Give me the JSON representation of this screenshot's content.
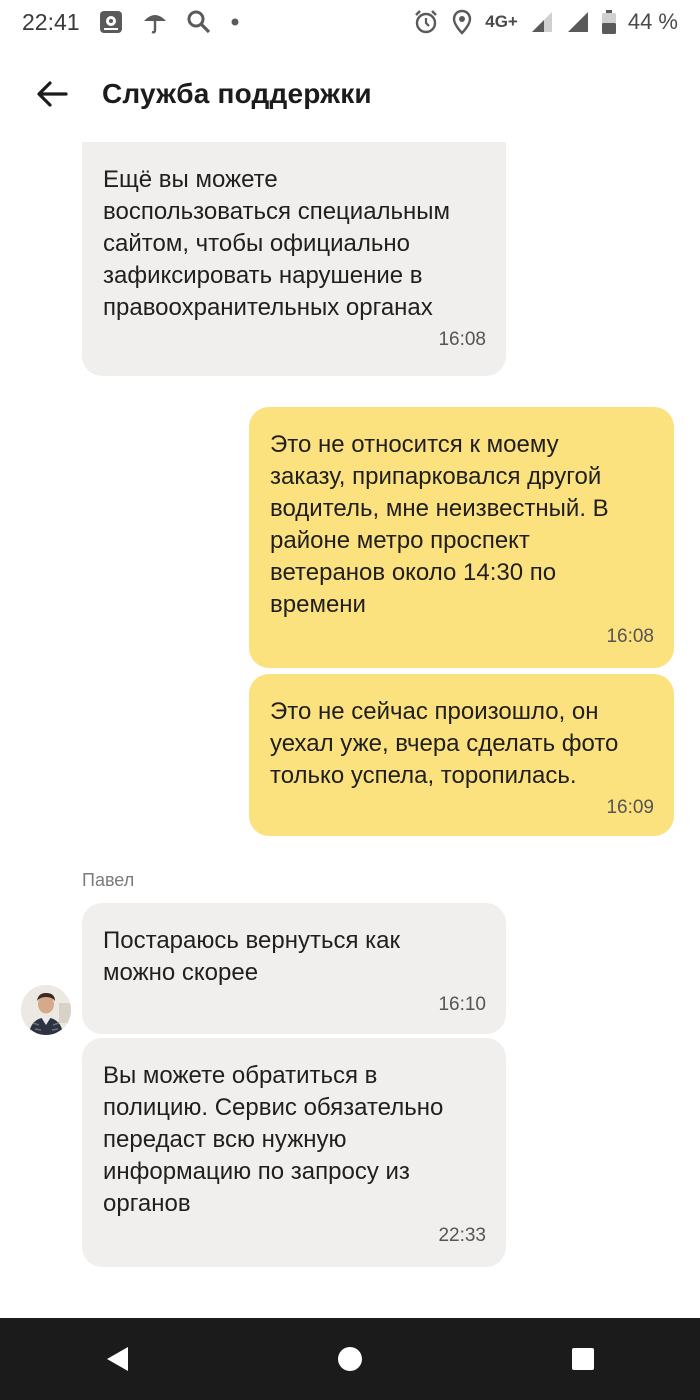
{
  "status_bar": {
    "time": "22:41",
    "network": "4G+",
    "battery": "44 %",
    "icons": [
      "app-notification-icon",
      "umbrella-icon",
      "search-icon",
      "dot-icon",
      "alarm-icon",
      "location-icon",
      "signal-icon",
      "signal-icon",
      "battery-icon"
    ]
  },
  "header": {
    "title": "Служба поддержки",
    "back_icon": "arrow-left-icon"
  },
  "messages": [
    {
      "direction": "incoming",
      "text": "Ещё вы можете\nвоспользоваться специальным\nсайтом, чтобы официально\nзафиксировать нарушение в\nправоохранительных органах",
      "time": "16:08"
    },
    {
      "direction": "outgoing",
      "text": "Это не относится к моему\nзаказу, припарковался другой\nводитель, мне неизвестный. В\nрайоне метро проспект\nветеранов около 14:30 по\nвремени",
      "time": "16:08"
    },
    {
      "direction": "outgoing",
      "text": "Это не сейчас произошло, он\nуехал уже, вчера сделать фото\nтолько успела, торопилась.",
      "time": "16:09"
    },
    {
      "direction": "incoming",
      "sender": "Павел",
      "text": "Постараюсь вернуться как\nможно скорее",
      "time": "16:10"
    },
    {
      "direction": "incoming",
      "text": "Вы можете обратиться в\nполицию. Сервис обязательно\nпередаст всю нужную\nинформацию по запросу из\nорганов",
      "time": "22:33"
    }
  ],
  "nav_bar": {
    "buttons": [
      "back-triangle-icon",
      "home-circle-icon",
      "recents-square-icon"
    ]
  },
  "colors": {
    "incoming_bubble": "#f0efed",
    "outgoing_bubble": "#fce17f",
    "nav_background": "#1b1b1b"
  }
}
